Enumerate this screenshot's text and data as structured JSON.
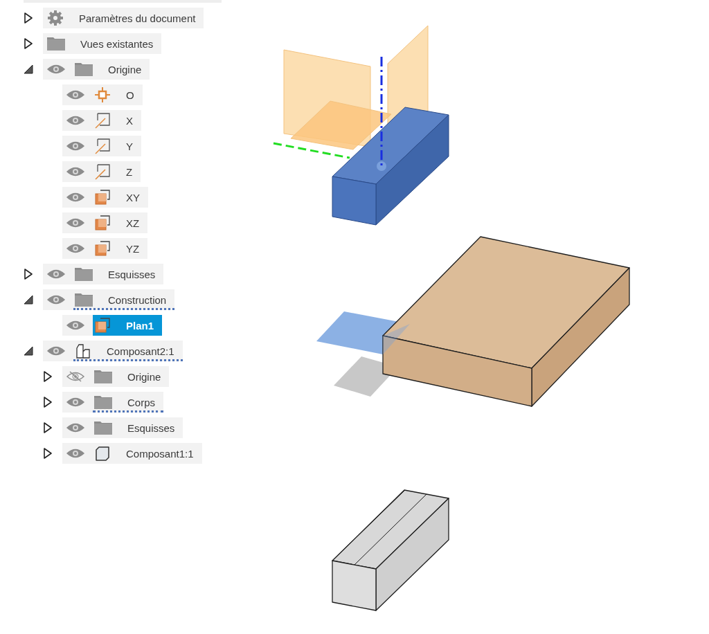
{
  "browser": {
    "items": [
      {
        "label": "Paramètres du document",
        "kind": "gear",
        "expanded": false,
        "selected": false,
        "underlined": false
      },
      {
        "label": "Vues existantes",
        "kind": "folder",
        "expanded": false,
        "selected": false,
        "underlined": false
      },
      {
        "label": "Origine",
        "kind": "folder",
        "visible": true,
        "expanded": true,
        "selected": false,
        "underlined": false,
        "children": [
          {
            "label": "O",
            "kind": "point",
            "visible": true,
            "selected": false,
            "underlined": false
          },
          {
            "label": "X",
            "kind": "axis",
            "visible": true,
            "selected": false,
            "underlined": false
          },
          {
            "label": "Y",
            "kind": "axis",
            "visible": true,
            "selected": false,
            "underlined": false
          },
          {
            "label": "Z",
            "kind": "axis",
            "visible": true,
            "selected": false,
            "underlined": false
          },
          {
            "label": "XY",
            "kind": "plane",
            "visible": true,
            "selected": false,
            "underlined": false
          },
          {
            "label": "XZ",
            "kind": "plane",
            "visible": true,
            "selected": false,
            "underlined": false
          },
          {
            "label": "YZ",
            "kind": "plane",
            "visible": true,
            "selected": false,
            "underlined": false
          }
        ]
      },
      {
        "label": "Esquisses",
        "kind": "folder",
        "visible": true,
        "expanded": false,
        "selected": false,
        "underlined": false
      },
      {
        "label": "Construction",
        "kind": "folder",
        "visible": true,
        "expanded": true,
        "selected": false,
        "underlined": true,
        "children": [
          {
            "label": "Plan1",
            "kind": "plane",
            "visible": true,
            "selected": true,
            "underlined": false
          }
        ]
      },
      {
        "label": "Composant2:1",
        "kind": "component",
        "visible": true,
        "expanded": true,
        "selected": false,
        "underlined": true,
        "children": [
          {
            "label": "Origine",
            "kind": "folder",
            "visible": false,
            "expanded": false,
            "selected": false,
            "underlined": false
          },
          {
            "label": "Corps",
            "kind": "folder",
            "visible": true,
            "expanded": false,
            "selected": false,
            "underlined": true
          },
          {
            "label": "Esquisses",
            "kind": "folder",
            "visible": true,
            "expanded": false,
            "selected": false,
            "underlined": false
          },
          {
            "label": "Composant1:1",
            "kind": "body",
            "visible": true,
            "expanded": false,
            "selected": false,
            "underlined": false
          }
        ]
      }
    ]
  }
}
